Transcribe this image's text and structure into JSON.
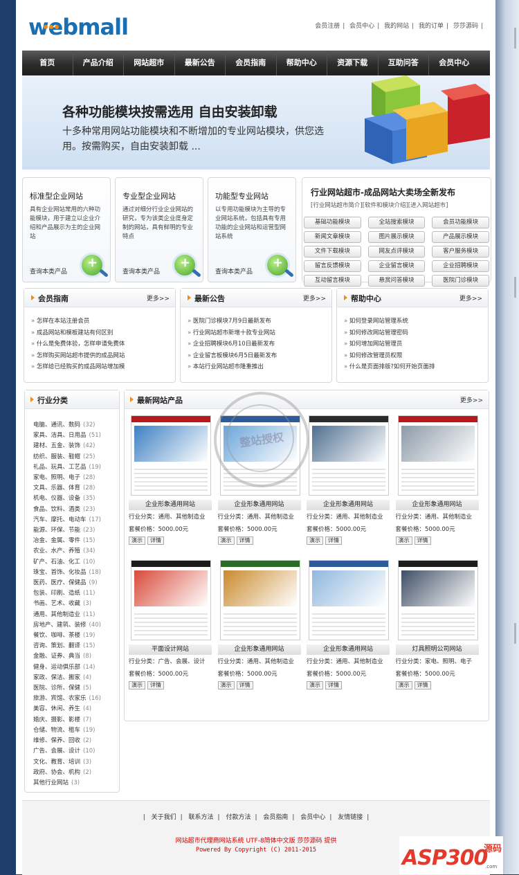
{
  "header": {
    "logo": "webmall",
    "top_links": [
      "会员注册",
      "会员中心",
      "我的网站",
      "我的订单",
      "莎莎源码"
    ]
  },
  "nav": [
    "首页",
    "产品介绍",
    "网站超市",
    "最新公告",
    "会员指南",
    "帮助中心",
    "资源下载",
    "互助问答",
    "会员中心"
  ],
  "banner": {
    "title": "各种功能模块按需选用 自由安装卸载",
    "text": "十多种常用网站功能模块和不断增加的专业网站模块，供您选用。按需购买，自由安装卸载 ..."
  },
  "product_boxes": [
    {
      "title": "标准型企业网站",
      "desc": "具有企业网站常用的六种功能模块，用于建立以企业介绍和产品展示为主的企业网站",
      "link": "查询本类产品"
    },
    {
      "title": "专业型企业网站",
      "desc": "通过对细分行业企业网站的研究，专为该类企业度身定制的网站，具有鲜明的专业特点",
      "link": "查询本类产品"
    },
    {
      "title": "功能型专业网站",
      "desc": "以专用功能模块为主导的专业网站系统，包括具有专用功能的企业网站和运营型网站系统",
      "link": "查询本类产品"
    }
  ],
  "market": {
    "title": "行业网站超市-成品网站大卖场全新发布",
    "sub": "[行业网站超市简介][软件和模块介绍][进入网站超市]",
    "modules": [
      "基础功能模块",
      "全站搜索模块",
      "会员功能模块",
      "新闻文章模块",
      "图片展示模块",
      "产品展示模块",
      "文件下载模块",
      "网友点评模块",
      "客户服务模块",
      "留言反馈模块",
      "企业留言模块",
      "企业招聘模块",
      "互动留言模块",
      "悬赏问答模块",
      "医院门诊模块"
    ]
  },
  "panels": [
    {
      "title": "会员指南",
      "more": "更多>>",
      "items": [
        "怎样在本站注册会员",
        "成品网站和模板建站有何区别",
        "什么是免费体验，怎样申请免费体",
        "怎样购买网站超市提供的成品网站",
        "怎样给已经购买的成品网站增加模"
      ]
    },
    {
      "title": "最新公告",
      "more": "更多>>",
      "items": [
        "医院门诊模块7月9日最新发布",
        "行业网站超市新增十款专业网站",
        "企业招聘模块6月10日最新发布",
        "企业留言板模块6月5日最新发布",
        "本站行业网站超市隆重推出"
      ]
    },
    {
      "title": "帮助中心",
      "more": "更多>>",
      "items": [
        "如何登录网站管理系统",
        "如何修改网站管理密码",
        "如何增加网站管理员",
        "如何修改管理员权限",
        "什么是页面排版?如何开始页面排"
      ]
    }
  ],
  "categories": {
    "title": "行业分类",
    "items": [
      {
        "name": "电脑、通讯、数码",
        "count": "(32)"
      },
      {
        "name": "家具、洁具、日用品",
        "count": "(51)"
      },
      {
        "name": "建材、五金、装饰",
        "count": "(42)"
      },
      {
        "name": "纺织、服装、鞋帽",
        "count": "(25)"
      },
      {
        "name": "礼品、玩具、工艺品",
        "count": "(19)"
      },
      {
        "name": "家电、照明、电子",
        "count": "(28)"
      },
      {
        "name": "文具、乐器、体育",
        "count": "(28)"
      },
      {
        "name": "机电、仪器、设备",
        "count": "(35)"
      },
      {
        "name": "食品、饮料、酒类",
        "count": "(23)"
      },
      {
        "name": "汽车、摩托、电动车",
        "count": "(17)"
      },
      {
        "name": "能源、环保、节能",
        "count": "(23)"
      },
      {
        "name": "冶金、金属、零件",
        "count": "(15)"
      },
      {
        "name": "农业、水产、养殖",
        "count": "(34)"
      },
      {
        "name": "矿产、石油、化工",
        "count": "(10)"
      },
      {
        "name": "珠宝、首饰、化妆品",
        "count": "(18)"
      },
      {
        "name": "医药、医疗、保健品",
        "count": "(9)"
      },
      {
        "name": "包装、印刷、造纸",
        "count": "(11)"
      },
      {
        "name": "书画、艺术、收藏",
        "count": "(3)"
      },
      {
        "name": "通用、其他制造业",
        "count": "(11)"
      },
      {
        "name": "房地产、建筑、装修",
        "count": "(40)"
      },
      {
        "name": "餐饮、咖啡、茶楼",
        "count": "(19)"
      },
      {
        "name": "咨询、策划、翻译",
        "count": "(15)"
      },
      {
        "name": "金融、证券、典当",
        "count": "(8)"
      },
      {
        "name": "健身、运动俱乐部",
        "count": "(14)"
      },
      {
        "name": "家政、保洁、搬家",
        "count": "(4)"
      },
      {
        "name": "医院、诊所、保健",
        "count": "(5)"
      },
      {
        "name": "旅游、宾馆、农家乐",
        "count": "(16)"
      },
      {
        "name": "美容、休闲、养生",
        "count": "(4)"
      },
      {
        "name": "婚庆、摄影、影楼",
        "count": "(7)"
      },
      {
        "name": "仓储、物流、租车",
        "count": "(19)"
      },
      {
        "name": "维修、保养、回收",
        "count": "(2)"
      },
      {
        "name": "广告、会展、设计",
        "count": "(10)"
      },
      {
        "name": "文化、教育、培训",
        "count": "(3)"
      },
      {
        "name": "政府、协会、机构",
        "count": "(2)"
      },
      {
        "name": "其他行业网站",
        "count": "(3)"
      }
    ]
  },
  "latest": {
    "title": "最新网站产品",
    "more": "更多>>",
    "demo": "演示",
    "detail": "详情",
    "products": [
      {
        "name": "企业形象通用网站",
        "cat": "行业分类：通用、其他制造业",
        "price": "套餐价格：5000.00元",
        "bar": "#b8171e",
        "pic": "#3c7fc2"
      },
      {
        "name": "企业形象通用网站",
        "cat": "行业分类：通用、其他制造业",
        "price": "套餐价格：5000.00元",
        "bar": "#2d5b9a",
        "pic": "#6aa4d9"
      },
      {
        "name": "企业形象通用网站",
        "cat": "行业分类：通用、其他制造业",
        "price": "套餐价格：5000.00元",
        "bar": "#2b2b2b",
        "pic": "#4e6f8f"
      },
      {
        "name": "企业形象通用网站",
        "cat": "行业分类：通用、其他制造业",
        "price": "套餐价格：5000.00元",
        "bar": "#b8171e",
        "pic": "#8c9aa8"
      },
      {
        "name": "平面设计网站",
        "cat": "行业分类：广告、会展、设计",
        "price": "套餐价格：5000.00元",
        "bar": "#1b1b1b",
        "pic": "#d84a3a"
      },
      {
        "name": "企业形象通用网站",
        "cat": "行业分类：通用、其他制造业",
        "price": "套餐价格：5000.00元",
        "bar": "#2e6b2a",
        "pic": "#c98a2d"
      },
      {
        "name": "企业形象通用网站",
        "cat": "行业分类：通用、其他制造业",
        "price": "套餐价格：5000.00元",
        "bar": "#2d5b9a",
        "pic": "#8fb8de"
      },
      {
        "name": "灯具照明公司网站",
        "cat": "行业分类：家电、照明、电子",
        "price": "套餐价格：5000.00元",
        "bar": "#1d1d1d",
        "pic": "#3f4e66"
      }
    ]
  },
  "watermark": "整站授权",
  "footer": {
    "links": [
      "关于我们",
      "联系方法",
      "付款方法",
      "会员指南",
      "会员中心",
      "友情链接"
    ],
    "line1": "网站超市代理商网站系统 UTF-8简体中文版 莎莎源码 提供",
    "line2": "Powered By  Copyright (C) 2011-2015"
  },
  "asp_logo": {
    "big": "ASP300",
    "small": "源码",
    "tag": ".com"
  }
}
